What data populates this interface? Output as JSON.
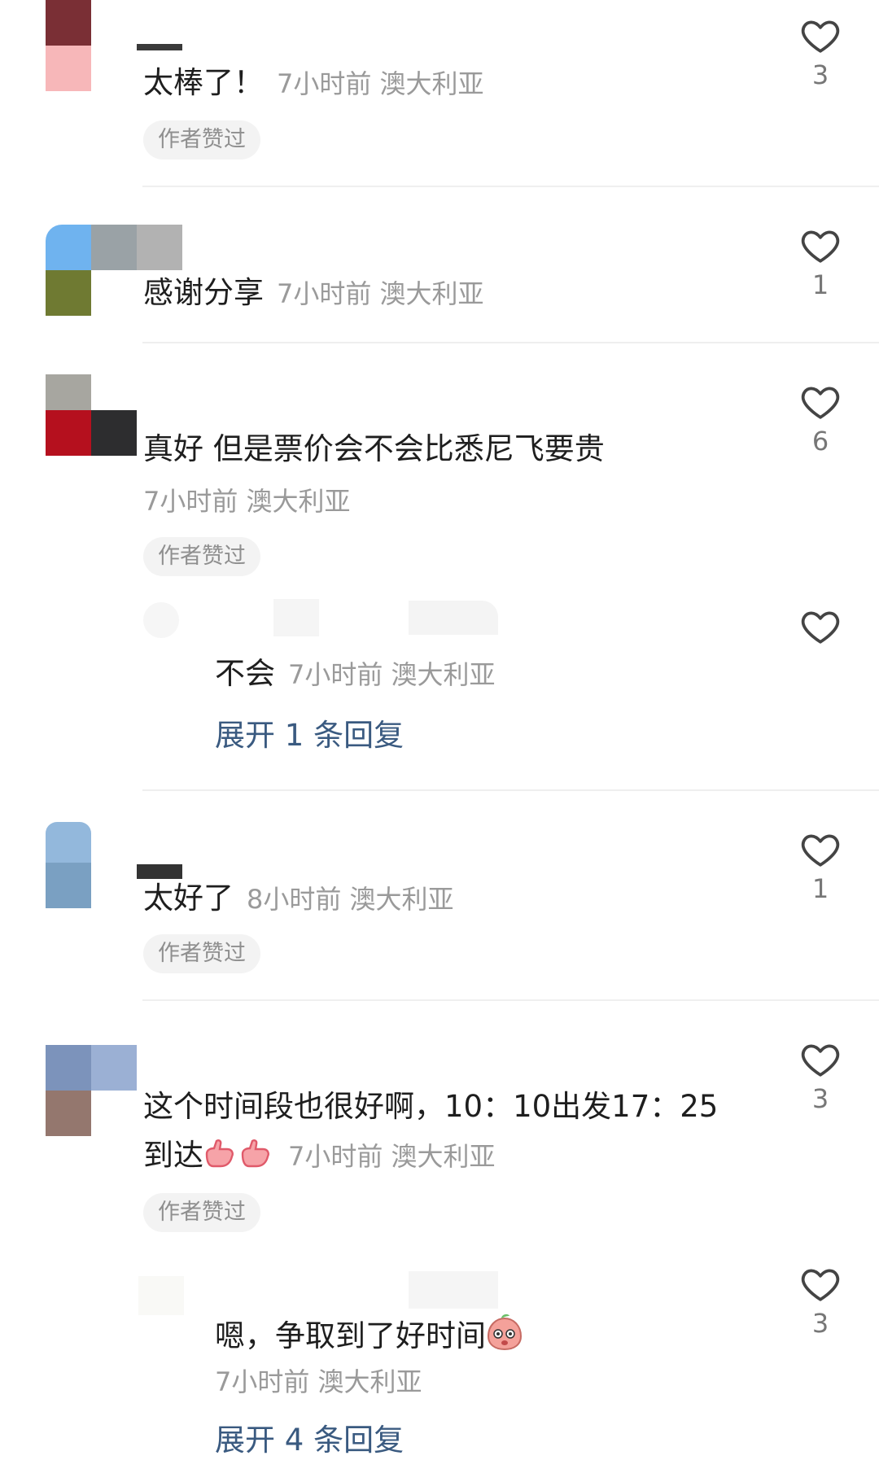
{
  "colors": {
    "link": "#3a5a80",
    "meta": "#9a9a9a",
    "tag_bg": "#f3f3f3"
  },
  "comments": [
    {
      "text": "太棒了！",
      "meta": "7小时前 澳大利亚",
      "author_liked": "作者赞过",
      "likes": "3"
    },
    {
      "text": "感谢分享",
      "meta": "7小时前 澳大利亚",
      "likes": "1"
    },
    {
      "text": "真好 但是票价会不会比悉尼飞要贵",
      "meta": "7小时前 澳大利亚",
      "author_liked": "作者赞过",
      "likes": "6",
      "reply": {
        "text": "不会",
        "meta": "7小时前 澳大利亚",
        "expand": "展开 1 条回复"
      }
    },
    {
      "text": "太好了",
      "meta": "8小时前 澳大利亚",
      "author_liked": "作者赞过",
      "likes": "1"
    },
    {
      "text_line1": "这个时间段也很好啊，10：10出发17：25",
      "text_line2": "到达",
      "meta": "7小时前 澳大利亚",
      "author_liked": "作者赞过",
      "likes": "3",
      "reply": {
        "text": "嗯，争取到了好时间",
        "meta": "7小时前 澳大利亚",
        "likes": "3",
        "expand": "展开 4 条回复"
      }
    }
  ],
  "icons": {
    "like": "heart-outline-icon",
    "emoji_thumb": "thumbs-up-emoji",
    "emoji_face": "peach-face-emoji"
  }
}
